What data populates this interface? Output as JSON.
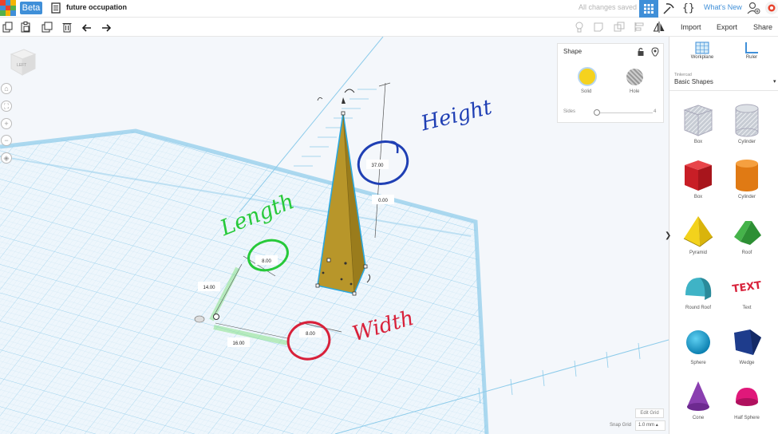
{
  "header": {
    "beta_label": "Beta",
    "document_title": "future occupation",
    "save_status": "All changes saved",
    "whats_new": "What's New"
  },
  "toolbar": {
    "import_label": "Import",
    "export_label": "Export",
    "share_label": "Share"
  },
  "viewcube": {
    "face_label": "LEFT"
  },
  "shape_panel": {
    "title": "Shape",
    "solid_label": "Solid",
    "hole_label": "Hole",
    "sides_label": "Sides",
    "sides_value": "4"
  },
  "dimensions": {
    "height": "37.00",
    "elevation": "0.00",
    "length": "8.00",
    "width": "8.00",
    "length_offset": "14.00",
    "width_offset": "16.00"
  },
  "annotations": {
    "height": "Height",
    "length": "Length",
    "width": "Width"
  },
  "grid": {
    "edit_label": "Edit Grid",
    "snap_label": "Snap Grid",
    "snap_value": "1.0 mm"
  },
  "right_panel": {
    "workplane_label": "Workplane",
    "ruler_label": "Ruler",
    "library_brand": "Tinkercad",
    "library_name": "Basic Shapes",
    "shapes": [
      {
        "label": "Box",
        "icon": "box-hole-icon"
      },
      {
        "label": "Cylinder",
        "icon": "cylinder-hole-icon"
      },
      {
        "label": "Box",
        "icon": "box-icon"
      },
      {
        "label": "Cylinder",
        "icon": "cylinder-icon"
      },
      {
        "label": "Pyramid",
        "icon": "pyramid-icon"
      },
      {
        "label": "Roof",
        "icon": "roof-icon"
      },
      {
        "label": "Round Roof",
        "icon": "round-roof-icon"
      },
      {
        "label": "Text",
        "icon": "text-shape-icon"
      },
      {
        "label": "Sphere",
        "icon": "sphere-icon"
      },
      {
        "label": "Wedge",
        "icon": "wedge-icon"
      },
      {
        "label": "Cone",
        "icon": "cone-icon"
      },
      {
        "label": "Half Sphere",
        "icon": "half-sphere-icon"
      }
    ]
  },
  "colors": {
    "accent": "#3f8fd8",
    "solid_yellow": "#f5d21e",
    "pyramid_gold": "#b8962a",
    "annotation_blue": "#1f3fb4",
    "annotation_green": "#27c93a",
    "annotation_red": "#d8213a",
    "grid_blue": "#9fd3ee"
  }
}
